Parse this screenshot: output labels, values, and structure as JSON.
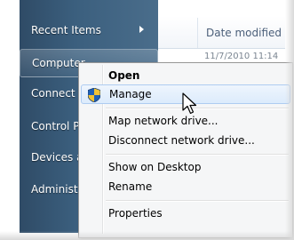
{
  "start_menu": {
    "items": [
      {
        "label": "Recent Items",
        "has_submenu": true
      },
      {
        "label": "Computer"
      },
      {
        "label": "Connect T"
      },
      {
        "label": "Control P"
      },
      {
        "label": "Devices a"
      },
      {
        "label": "Administr"
      }
    ]
  },
  "explorer": {
    "column_header": "Date modified",
    "first_row_date": "11/7/2010 11:14"
  },
  "context_menu": {
    "items": [
      {
        "label": "Open",
        "bold": true
      },
      {
        "label": "Manage",
        "icon": "uac-shield-icon",
        "hover": true
      },
      {
        "label": "Map network drive..."
      },
      {
        "label": "Disconnect network drive..."
      },
      {
        "label": "Show on Desktop"
      },
      {
        "label": "Rename"
      },
      {
        "label": "Properties"
      }
    ]
  },
  "colors": {
    "start_pane": "#3b5f7e",
    "menu_hover_border": "#aeccf1",
    "menu_bg": "#f5f6f7"
  }
}
